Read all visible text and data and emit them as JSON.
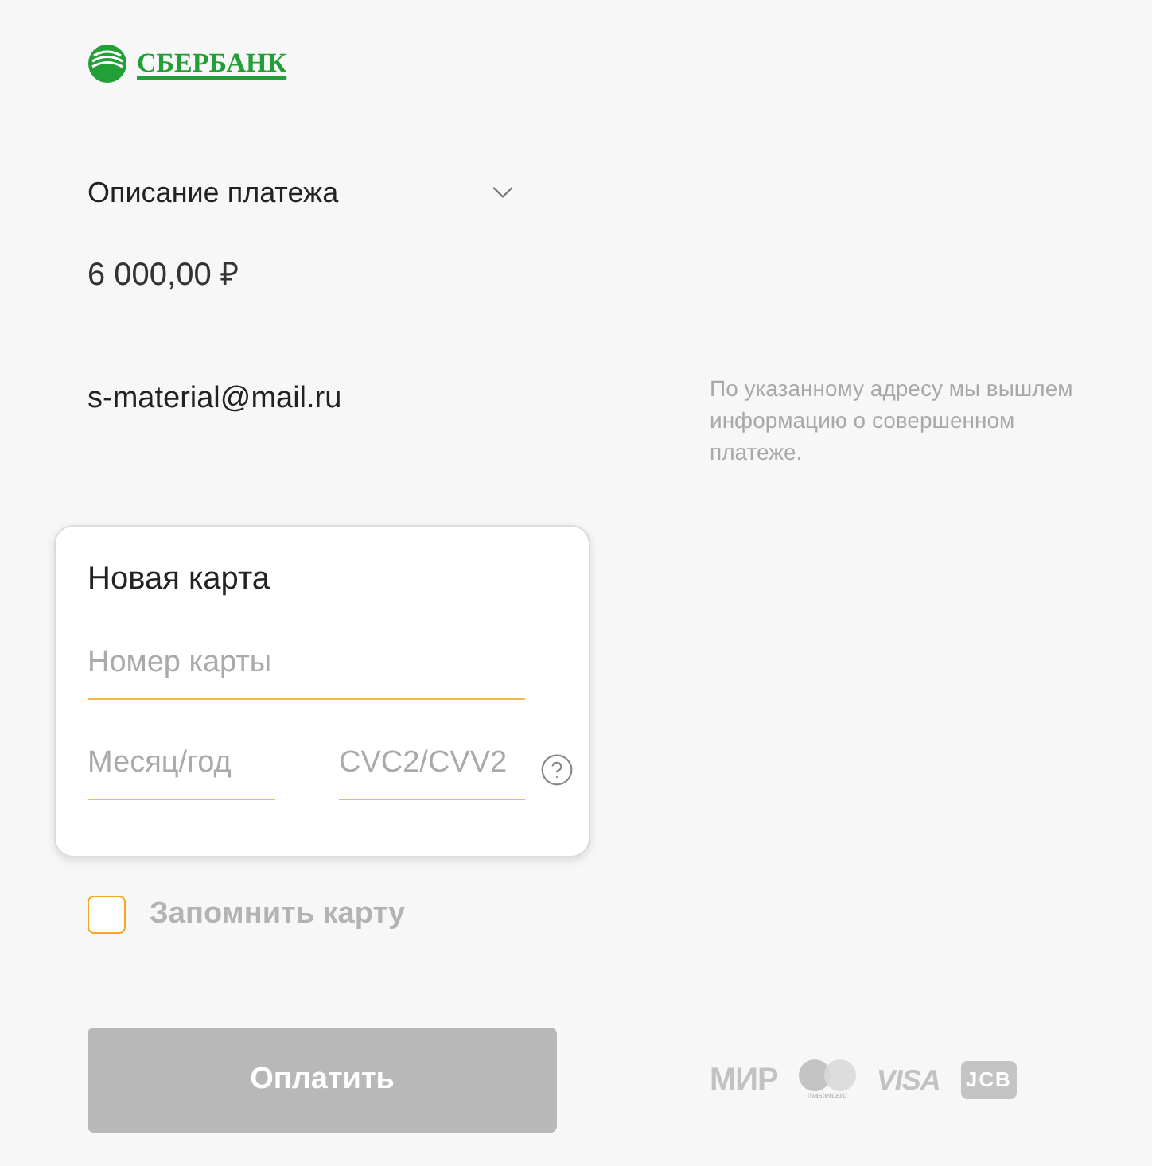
{
  "logo": {
    "text": "СБЕРБАНК"
  },
  "description": {
    "label": "Описание платежа",
    "expanded": false
  },
  "amount": "6 000,00 ₽",
  "email": {
    "value": "s-material@mail.ru",
    "hint": "По указанному адресу мы вышлем информацию о совершенном платеже."
  },
  "card_form": {
    "title": "Новая карта",
    "fields": [
      {
        "placeholder": "Номер карты"
      },
      {
        "placeholder": "Месяц/год"
      },
      {
        "placeholder": "CVC2/CVV2"
      }
    ]
  },
  "remember_card": {
    "label": "Запомнить карту",
    "checked": false
  },
  "pay_button": {
    "label": "Оплатить",
    "disabled": true
  },
  "payment_systems": [
    {
      "kind": "mir",
      "label": "МИР"
    },
    {
      "kind": "mastercard",
      "label": "mastercard"
    },
    {
      "kind": "visa",
      "label": "VISA"
    },
    {
      "kind": "jcb",
      "label": "JCB"
    }
  ]
}
